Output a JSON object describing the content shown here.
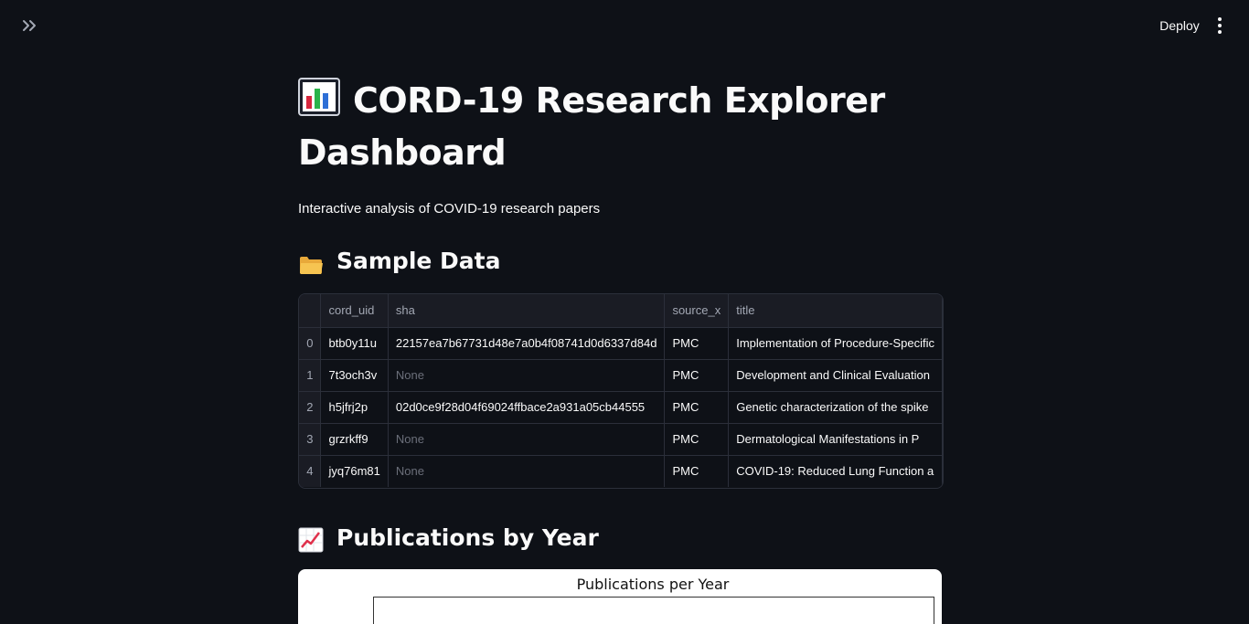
{
  "header": {
    "deploy_label": "Deploy"
  },
  "page": {
    "title": "CORD-19 Research Explorer Dashboard",
    "subtitle": "Interactive analysis of COVID-19 research papers"
  },
  "sample_section": {
    "heading": "Sample Data",
    "columns": [
      "",
      "cord_uid",
      "sha",
      "source_x",
      "title"
    ],
    "rows": [
      {
        "index": "0",
        "cord_uid": "btb0y11u",
        "sha": "22157ea7b67731d48e7a0b4f08741d0d6337d84d",
        "source_x": "PMC",
        "title": "Implementation of Procedure-Specific"
      },
      {
        "index": "1",
        "cord_uid": "7t3och3v",
        "sha": "None",
        "source_x": "PMC",
        "title": "Development and Clinical Evaluation"
      },
      {
        "index": "2",
        "cord_uid": "h5jfrj2p",
        "sha": "02d0ce9f28d04f69024ffbace2a931a05cb44555",
        "source_x": "PMC",
        "title": "Genetic characterization of the spike"
      },
      {
        "index": "3",
        "cord_uid": "grzrkff9",
        "sha": "None",
        "source_x": "PMC",
        "title": "Dermatological Manifestations in P"
      },
      {
        "index": "4",
        "cord_uid": "jyq76m81",
        "sha": "None",
        "source_x": "PMC",
        "title": "COVID-19: Reduced Lung Function a"
      }
    ]
  },
  "pubs_section": {
    "heading": "Publications by Year",
    "chart_title": "Publications per Year"
  },
  "icons": {
    "sidebar_toggle": "double-chevron-right-icon",
    "menu": "vertical-dots-icon",
    "title_emoji": "bar-chart-icon",
    "sample_emoji": "folder-icon",
    "pubs_emoji": "line-chart-icon"
  }
}
